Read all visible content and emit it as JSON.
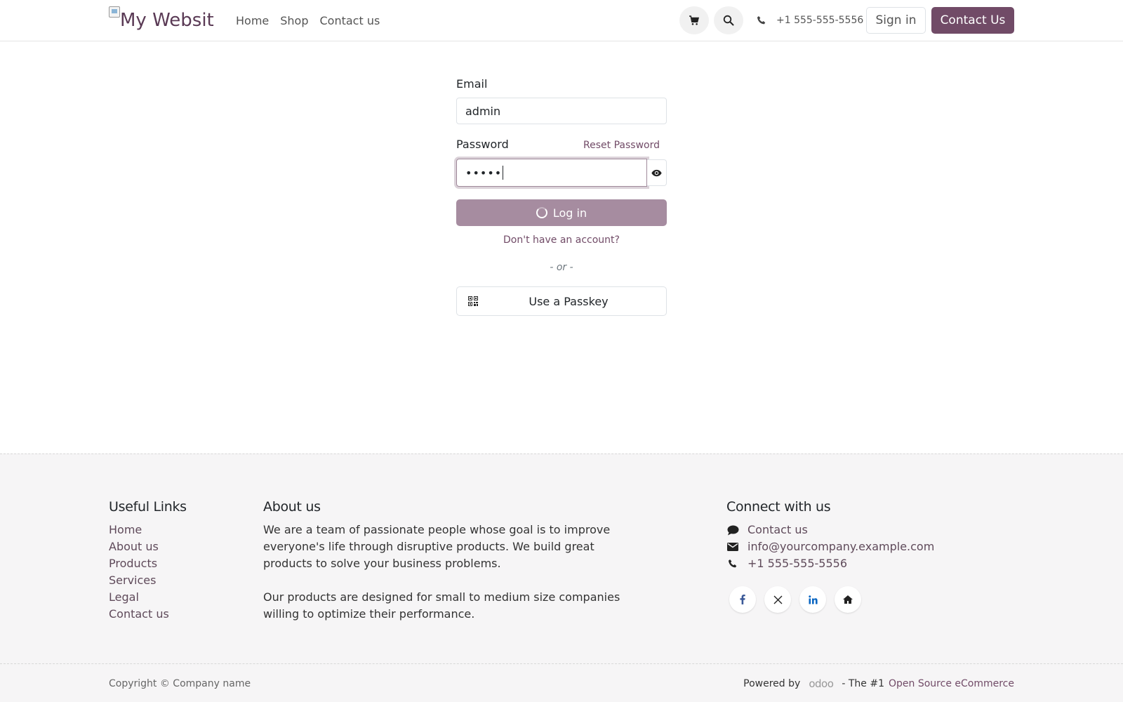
{
  "header": {
    "logo_alt": "My Websit",
    "nav": [
      "Home",
      "Shop",
      "Contact us"
    ],
    "phone": "+1 555-555-5556",
    "sign_in": "Sign in",
    "contact_us": "Contact Us"
  },
  "login": {
    "email_label": "Email",
    "email_value": "admin",
    "password_label": "Password",
    "reset_password": "Reset Password",
    "password_mask": "•••••",
    "login_button": "Log in",
    "no_account": "Don't have an account?",
    "or": "- or -",
    "passkey_button": "Use a Passkey"
  },
  "footer": {
    "useful_links_title": "Useful Links",
    "useful_links": [
      "Home",
      "About us",
      "Products",
      "Services",
      "Legal",
      "Contact us"
    ],
    "about_title": "About us",
    "about_p1": "We are a team of passionate people whose goal is to improve everyone's life through disruptive products. We build great products to solve your business problems.",
    "about_p2": "Our products are designed for small to medium size companies willing to optimize their performance.",
    "connect_title": "Connect with us",
    "connect_contact": "Contact us",
    "connect_email": "info@yourcompany.example.com",
    "connect_phone": "+1 555-555-5556",
    "copyright": "Copyright © Company name",
    "powered_by": "Powered by",
    "odoo": "odoo",
    "the_1": "- The #1",
    "open_source": "Open Source eCommerce"
  },
  "colors": {
    "brand": "#714b67",
    "brand_disabled": "#a68ca0"
  }
}
